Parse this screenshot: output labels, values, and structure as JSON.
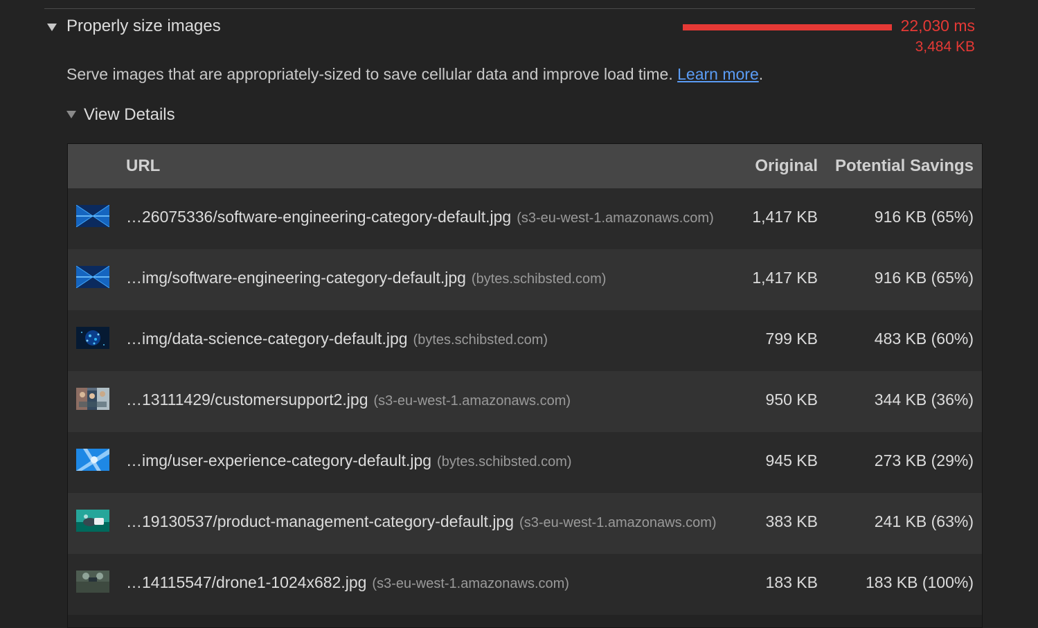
{
  "audit": {
    "title": "Properly size images",
    "metric_ms": "22,030 ms",
    "metric_kb": "3,484 KB",
    "metric_color": "#e53935",
    "description": "Serve images that are appropriately-sized to save cellular data and improve load time.",
    "learn_more": "Learn more",
    "description_end": ".",
    "view_details": "View Details"
  },
  "table": {
    "headers": {
      "url": "URL",
      "original": "Original",
      "savings": "Potential Savings"
    },
    "rows": [
      {
        "path": "…26075336/software-engineering-category-default.jpg",
        "host": "(s3-eu-west-1.amazonaws.com)",
        "original": "1,417 KB",
        "savings": "916 KB (65%)",
        "thumb_icon": "blue-tech-thumbnail"
      },
      {
        "path": "…img/software-engineering-category-default.jpg",
        "host": "(bytes.schibsted.com)",
        "original": "1,417 KB",
        "savings": "916 KB (65%)",
        "thumb_icon": "blue-tech-thumbnail"
      },
      {
        "path": "…img/data-science-category-default.jpg",
        "host": "(bytes.schibsted.com)",
        "original": "799 KB",
        "savings": "483 KB (60%)",
        "thumb_icon": "data-particles-thumbnail"
      },
      {
        "path": "…13111429/customersupport2.jpg",
        "host": "(s3-eu-west-1.amazonaws.com)",
        "original": "950 KB",
        "savings": "344 KB (36%)",
        "thumb_icon": "people-thumbnail"
      },
      {
        "path": "…img/user-experience-category-default.jpg",
        "host": "(bytes.schibsted.com)",
        "original": "945 KB",
        "savings": "273 KB (29%)",
        "thumb_icon": "light-blue-burst-thumbnail"
      },
      {
        "path": "…19130537/product-management-category-default.jpg",
        "host": "(s3-eu-west-1.amazonaws.com)",
        "original": "383 KB",
        "savings": "241 KB (63%)",
        "thumb_icon": "hand-device-thumbnail"
      },
      {
        "path": "…14115547/drone1-1024x682.jpg",
        "host": "(s3-eu-west-1.amazonaws.com)",
        "original": "183 KB",
        "savings": "183 KB (100%)",
        "thumb_icon": "drone-thumbnail"
      }
    ]
  }
}
